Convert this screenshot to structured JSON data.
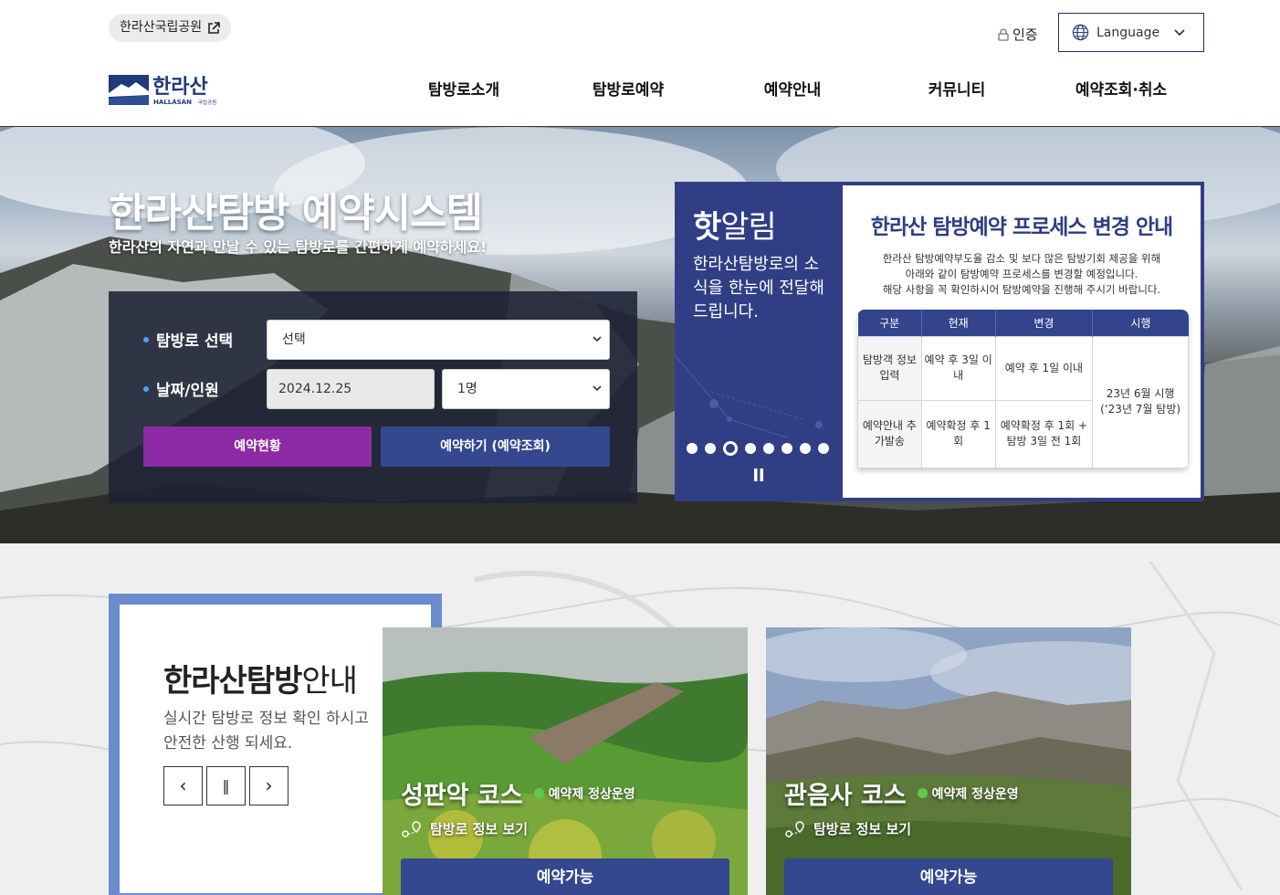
{
  "header": {
    "park_link": "한라산국립공원",
    "auth": "인증",
    "language": "Language",
    "logo_text": "한라산",
    "logo_sub": "HALLASAN",
    "logo_sub2": "국립공원",
    "nav": [
      "탐방로소개",
      "탐방로예약",
      "예약안내",
      "커뮤니티",
      "예약조회·취소"
    ]
  },
  "hero": {
    "title": "한라산탐방 예약시스템",
    "subtitle": "한라산의 자연과 만날 수 있는 탐방로를 간편하게 예약하세요!",
    "search": {
      "trail_label": "탐방로 선택",
      "trail_value": "선택",
      "date_label": "날짜/인원",
      "date_value": "2024.12.25",
      "people_value": "1명",
      "status_button": "예약현황",
      "reserve_button": "예약하기 (예약조회)"
    }
  },
  "notice": {
    "title_bold": "핫",
    "title_rest": "알림",
    "desc": "한라산탐방로의 소식을 한눈에 전달해 드립니다.",
    "slide_count": 8,
    "active_slide": 3,
    "popup": {
      "title": "한라산 탐방예약 프로세스 변경 안내",
      "lines": [
        "한라산 탐방예약부도율 감소 및 보다 많은 탐방기회 제공을 위해",
        "아래와 같이 탐방예약 프로세스를 변경할 예정입니다.",
        "해당 사항을 꼭 확인하시어 탐방예약을 진행해 주시기 바랍니다."
      ],
      "headers": [
        "구분",
        "현재",
        "변경",
        "시행"
      ],
      "rows": [
        [
          "탐방객 정보입력",
          "예약 후 3일 이내",
          "예약 후 1일 이내"
        ],
        [
          "예약안내 추가발송",
          "예약확정 후 1회",
          "예약확정 후 1회 + 탐방 3일 전 1회"
        ]
      ],
      "effective": "23년 6월 시행 (‘23년 7월 탐방)"
    }
  },
  "guide": {
    "title_bold": "한라산탐방",
    "title_rest": "안내",
    "text": "실시간 탐방로 정보 확인 하시고 안전한 산행 되세요.",
    "prev": "‹",
    "pause": "‖",
    "next": "›"
  },
  "courses": [
    {
      "name": "성판악 코스",
      "status": "예약제 정상운영",
      "info": "탐방로 정보 보기",
      "button": "예약가능"
    },
    {
      "name": "관음사 코스",
      "status": "예약제 정상운영",
      "info": "탐방로 정보 보기",
      "button": "예약가능"
    }
  ],
  "colors": {
    "navy": "#34478f",
    "purple": "#8c2ba3",
    "frame_blue": "#6b8ccc",
    "status_green": "#5fc84a"
  }
}
